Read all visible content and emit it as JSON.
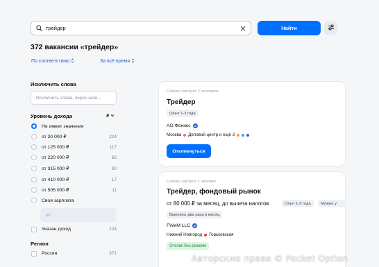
{
  "search": {
    "value": "трейдер",
    "find_label": "Найти"
  },
  "results": {
    "title": "372 вакансии «трейдер»"
  },
  "sort": {
    "relevance": "По соответствию",
    "period": "За всё время"
  },
  "sidebar": {
    "exclude_heading": "Исключить слова",
    "exclude_placeholder": "Исключить слова, через запя...",
    "income_heading": "Уровень дохода",
    "currency": "₽",
    "income_options": [
      {
        "label": "Не имеет значения",
        "count": "",
        "selected": true
      },
      {
        "label": "от 30 000 ₽",
        "count": "224",
        "selected": false
      },
      {
        "label": "от 125 000 ₽",
        "count": "117",
        "selected": false
      },
      {
        "label": "от 220 000 ₽",
        "count": "65",
        "selected": false
      },
      {
        "label": "от 315 000 ₽",
        "count": "30",
        "selected": false
      },
      {
        "label": "от 410 000 ₽",
        "count": "17",
        "selected": false
      },
      {
        "label": "от 505 000 ₽",
        "count": "11",
        "selected": false
      },
      {
        "label": "Своя зарплата",
        "count": "",
        "selected": false
      }
    ],
    "salary_placeholder": "от",
    "with_income_label": "Указан доход",
    "with_income_count": "224",
    "region_heading": "Регион",
    "region_first": "Россия",
    "region_first_count": "371"
  },
  "vacancies": [
    {
      "viewers": "Сейчас смотрят 2 человека",
      "title": "Трейдер",
      "tags": [
        "Опыт 1-3 года"
      ],
      "company": "АО Феникс",
      "city": "Москва",
      "metro": "Деловой центр и ещё 3",
      "apply_label": "Откликнуться"
    },
    {
      "viewers": "Сейчас смотрит 1 человек",
      "title": "Трейдер, фондовый рынок",
      "salary": "от 80 000 ₽ за месяц, до вычета налогов",
      "tags": [
        "Опыт 1-3 года",
        "Можно у"
      ],
      "payout": "Выплаты два раза в месяц",
      "company": "FWeM LLC",
      "city": "Нижний Новгород",
      "metro": "Горьковская",
      "badge": "Отклик без резюме"
    }
  ],
  "watermark": "Авторские права © Pocket Option",
  "colors": {
    "accent": "#0070ff",
    "link": "#2a62c9",
    "green": "#1f8a3b"
  }
}
